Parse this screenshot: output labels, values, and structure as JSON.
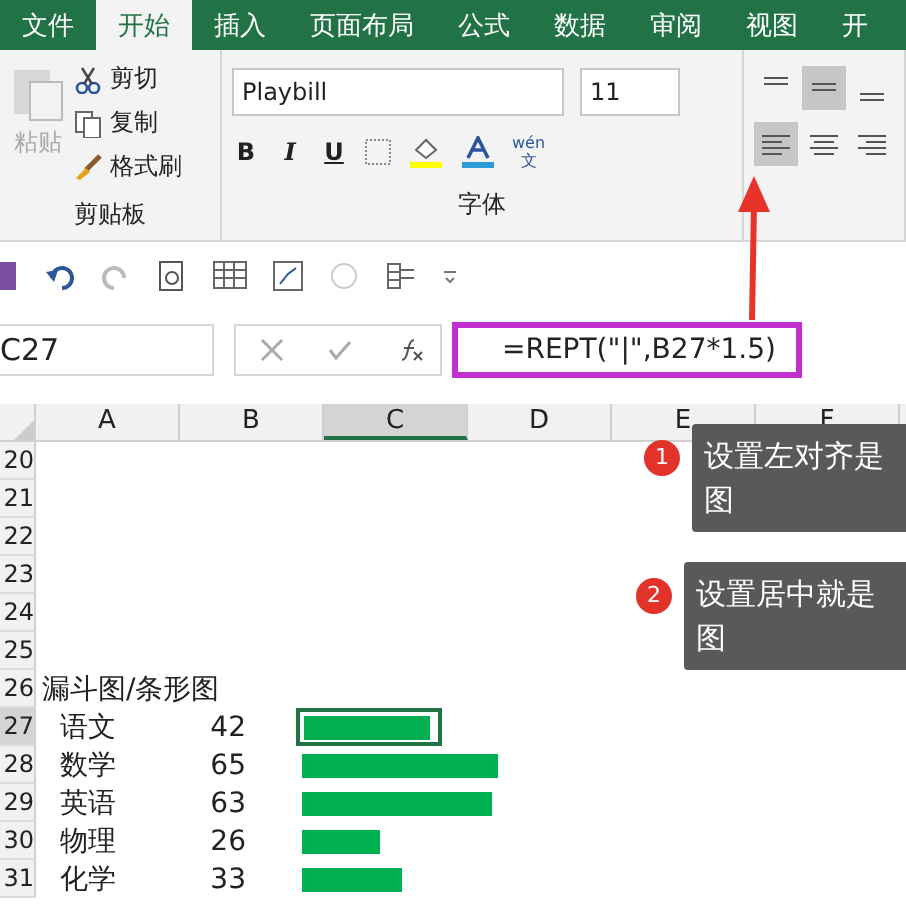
{
  "tabs": [
    {
      "label": "文件",
      "selected": false
    },
    {
      "label": "开始",
      "selected": true
    },
    {
      "label": "插入",
      "selected": false
    },
    {
      "label": "页面布局",
      "selected": false
    },
    {
      "label": "公式",
      "selected": false
    },
    {
      "label": "数据",
      "selected": false
    },
    {
      "label": "审阅",
      "selected": false
    },
    {
      "label": "视图",
      "selected": false
    },
    {
      "label": "开",
      "selected": false
    }
  ],
  "clipboard": {
    "paste": "粘贴",
    "cut": "剪切",
    "copy": "复制",
    "format_painter": "格式刷",
    "group_label": "剪贴板"
  },
  "font": {
    "name": "Playbill",
    "size": "11",
    "bold": "B",
    "italic": "I",
    "underline": "U",
    "phonetic_top": "wén",
    "phonetic_bottom": "文",
    "group_label": "字体"
  },
  "alignment": {
    "top_align_selected": false,
    "middle_align_selected": true,
    "left_align_selected": true
  },
  "name_box": "C27",
  "formula": "=REPT(\"|\",B27*1.5)",
  "columns": [
    "A",
    "B",
    "C",
    "D",
    "E",
    "F"
  ],
  "rows": [
    {
      "number": "20",
      "col_a": "",
      "col_b": ""
    },
    {
      "number": "21",
      "col_a": "",
      "col_b": ""
    },
    {
      "number": "22",
      "col_a": "",
      "col_b": ""
    },
    {
      "number": "23",
      "col_a": "",
      "col_b": ""
    },
    {
      "number": "24",
      "col_a": "",
      "col_b": ""
    },
    {
      "number": "25",
      "col_a": "",
      "col_b": ""
    },
    {
      "number": "26",
      "col_a": "漏斗图/条形图",
      "col_b": ""
    },
    {
      "number": "27",
      "col_a": "语文",
      "col_b": "42",
      "level": 0.63,
      "selected": true
    },
    {
      "number": "28",
      "col_a": "数学",
      "col_b": "65",
      "level": 0.975,
      "selected": false
    },
    {
      "number": "29",
      "col_a": "英语",
      "col_b": "63",
      "level": 0.945,
      "selected": false
    },
    {
      "number": "30",
      "col_a": "物理",
      "col_b": "26",
      "level": 0.39,
      "selected": false
    },
    {
      "number": "31",
      "col_a": "化学",
      "col_b": "33",
      "level": 0.495,
      "selected": false
    }
  ],
  "callouts": [
    {
      "number": "1",
      "lines": [
        "设置左对齐是",
        "图"
      ]
    },
    {
      "number": "2",
      "lines": [
        "设置居中就是",
        "图"
      ]
    }
  ]
}
